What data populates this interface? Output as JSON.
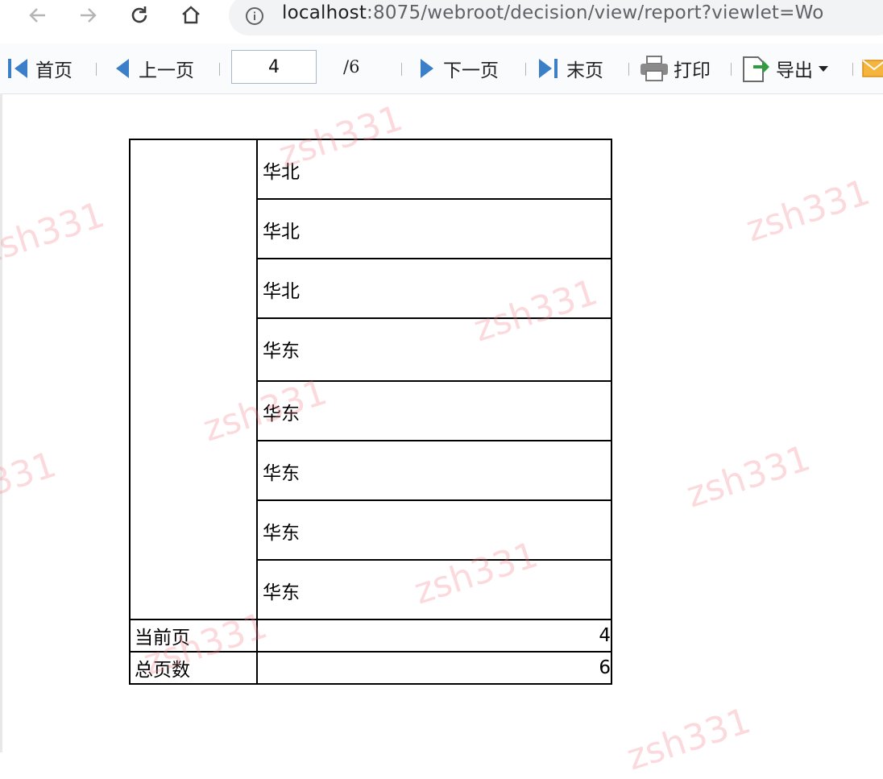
{
  "browser": {
    "url_host": "localhost",
    "url_path": ":8075/webroot/decision/view/report?viewlet=Wo"
  },
  "toolbar": {
    "first_label": "首页",
    "prev_label": "上一页",
    "page_value": "4",
    "page_total": "/6",
    "next_label": "下一页",
    "last_label": "末页",
    "print_label": "打印",
    "export_label": "导出"
  },
  "report": {
    "regions": [
      "华北",
      "华北",
      "华北",
      "华东",
      "华东",
      "华东",
      "华东",
      "华东"
    ],
    "current_page_label": "当前页",
    "current_page_value": "4",
    "total_pages_label": "总页数",
    "total_pages_value": "6"
  },
  "watermark": {
    "text": "zsh331"
  },
  "colors": {
    "toolbar_icon_blue": "#3a7fc8",
    "watermark": "#f07882"
  }
}
